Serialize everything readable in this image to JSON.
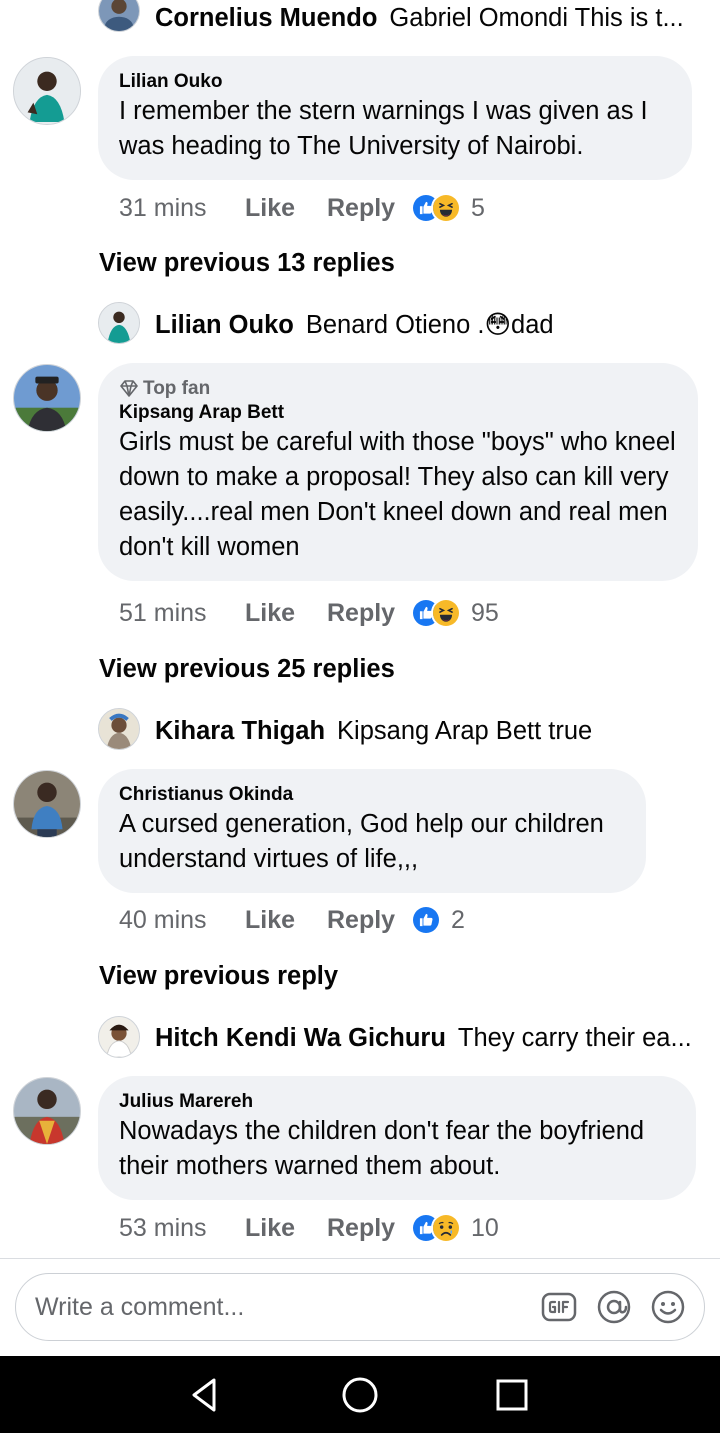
{
  "top_partial": {
    "name": "Cornelius Muendo",
    "text": "Gabriel Omondi This is t..."
  },
  "threads": [
    {
      "author": "Lilian Ouko",
      "text": "I remember the stern warnings I was given as I was heading to The University of Nairobi.",
      "time": "31 mins",
      "like": "Like",
      "reply": "Reply",
      "reactions": [
        "like",
        "haha"
      ],
      "count": "5",
      "view_previous": "View previous 13 replies",
      "latest_reply": {
        "name": "Lilian Ouko",
        "text": "Benard Otieno .😳dad"
      }
    },
    {
      "badge": "Top fan",
      "author": "Kipsang Arap Bett",
      "text": "Girls must be careful with those \"boys\" who kneel down to make a proposal! They also can kill very easily....real men Don't kneel down and real men don't kill women",
      "time": "51 mins",
      "like": "Like",
      "reply": "Reply",
      "reactions": [
        "like",
        "haha"
      ],
      "count": "95",
      "view_previous": "View previous 25 replies",
      "latest_reply": {
        "name": "Kihara Thigah",
        "text": "Kipsang Arap Bett true"
      }
    },
    {
      "author": "Christianus Okinda",
      "text": "A cursed generation, God help our children understand virtues of life,,,",
      "time": "40 mins",
      "like": "Like",
      "reply": "Reply",
      "reactions": [
        "like"
      ],
      "count": "2",
      "view_previous": "View previous reply",
      "latest_reply": {
        "name": "Hitch Kendi Wa Gichuru",
        "text": "They carry their  ea..."
      }
    },
    {
      "author": "Julius Marereh",
      "text": "Nowadays the children don't fear the boyfriend their mothers warned them about.",
      "time": "53 mins",
      "like": "Like",
      "reply": "Reply",
      "reactions": [
        "like",
        "sad"
      ],
      "count": "10"
    }
  ],
  "composer": {
    "placeholder": "Write a comment...",
    "icons": [
      "gif-icon",
      "mention-icon",
      "emoji-icon"
    ]
  },
  "system_nav": [
    "back-icon",
    "home-icon",
    "recents-icon"
  ],
  "colors": {
    "bubble": "#f0f2f5",
    "secondary_text": "#65676b",
    "like_blue": "#1877f2",
    "reaction_yellow": "#f7b928",
    "nav_bar": "#000000"
  }
}
